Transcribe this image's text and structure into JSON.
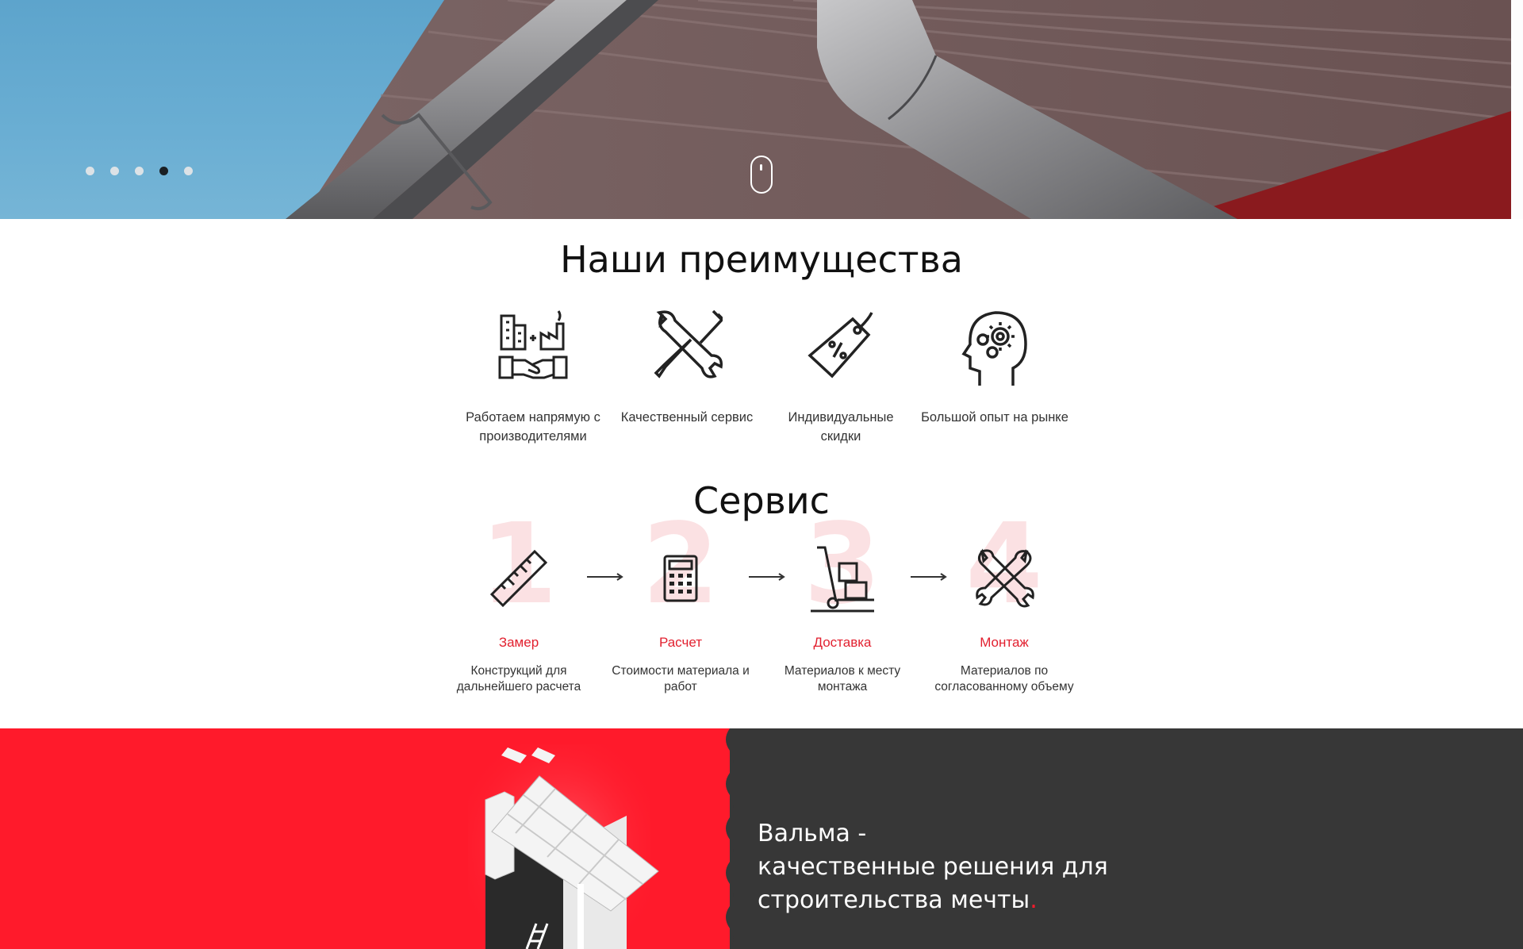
{
  "hero": {
    "slider_dots": [
      {
        "active": false
      },
      {
        "active": false
      },
      {
        "active": false
      },
      {
        "active": true
      },
      {
        "active": false
      }
    ]
  },
  "advantages": {
    "title": "Наши преимущества",
    "items": [
      {
        "icon": "factory-handshake-icon",
        "label_line1": "Работаем напрямую с",
        "label_line2": "производителями"
      },
      {
        "icon": "wrench-screwdriver-icon",
        "label_line1": "Качественный сервис",
        "label_line2": ""
      },
      {
        "icon": "price-tag-percent-icon",
        "label_line1": "Индивидуальные",
        "label_line2": "скидки"
      },
      {
        "icon": "head-gears-icon",
        "label_line1": "Большой опыт на рынке",
        "label_line2": ""
      }
    ]
  },
  "service": {
    "title": "Сервис",
    "steps": [
      {
        "number": "1",
        "icon": "ruler-icon",
        "name": "Замер",
        "desc_line1": "Конструкций для",
        "desc_line2": "дальнейшего расчета"
      },
      {
        "number": "2",
        "icon": "calculator-icon",
        "name": "Расчет",
        "desc_line1": "Стоимости материала и",
        "desc_line2": "работ"
      },
      {
        "number": "3",
        "icon": "hand-truck-icon",
        "name": "Доставка",
        "desc_line1": "Материалов к месту",
        "desc_line2": "монтажа"
      },
      {
        "number": "4",
        "icon": "wrench-cross-icon",
        "name": "Монтаж",
        "desc_line1": "Материалов по",
        "desc_line2": "согласованному объему"
      }
    ]
  },
  "promo": {
    "line1": "Вальма -",
    "line2": "качественные решения для",
    "line3": "строительства мечты",
    "dot": "."
  },
  "colors": {
    "accent": "#e2202f",
    "promo_red": "#ff1a2b",
    "promo_dark": "#373737",
    "number_tint": "#fbe1e3"
  }
}
